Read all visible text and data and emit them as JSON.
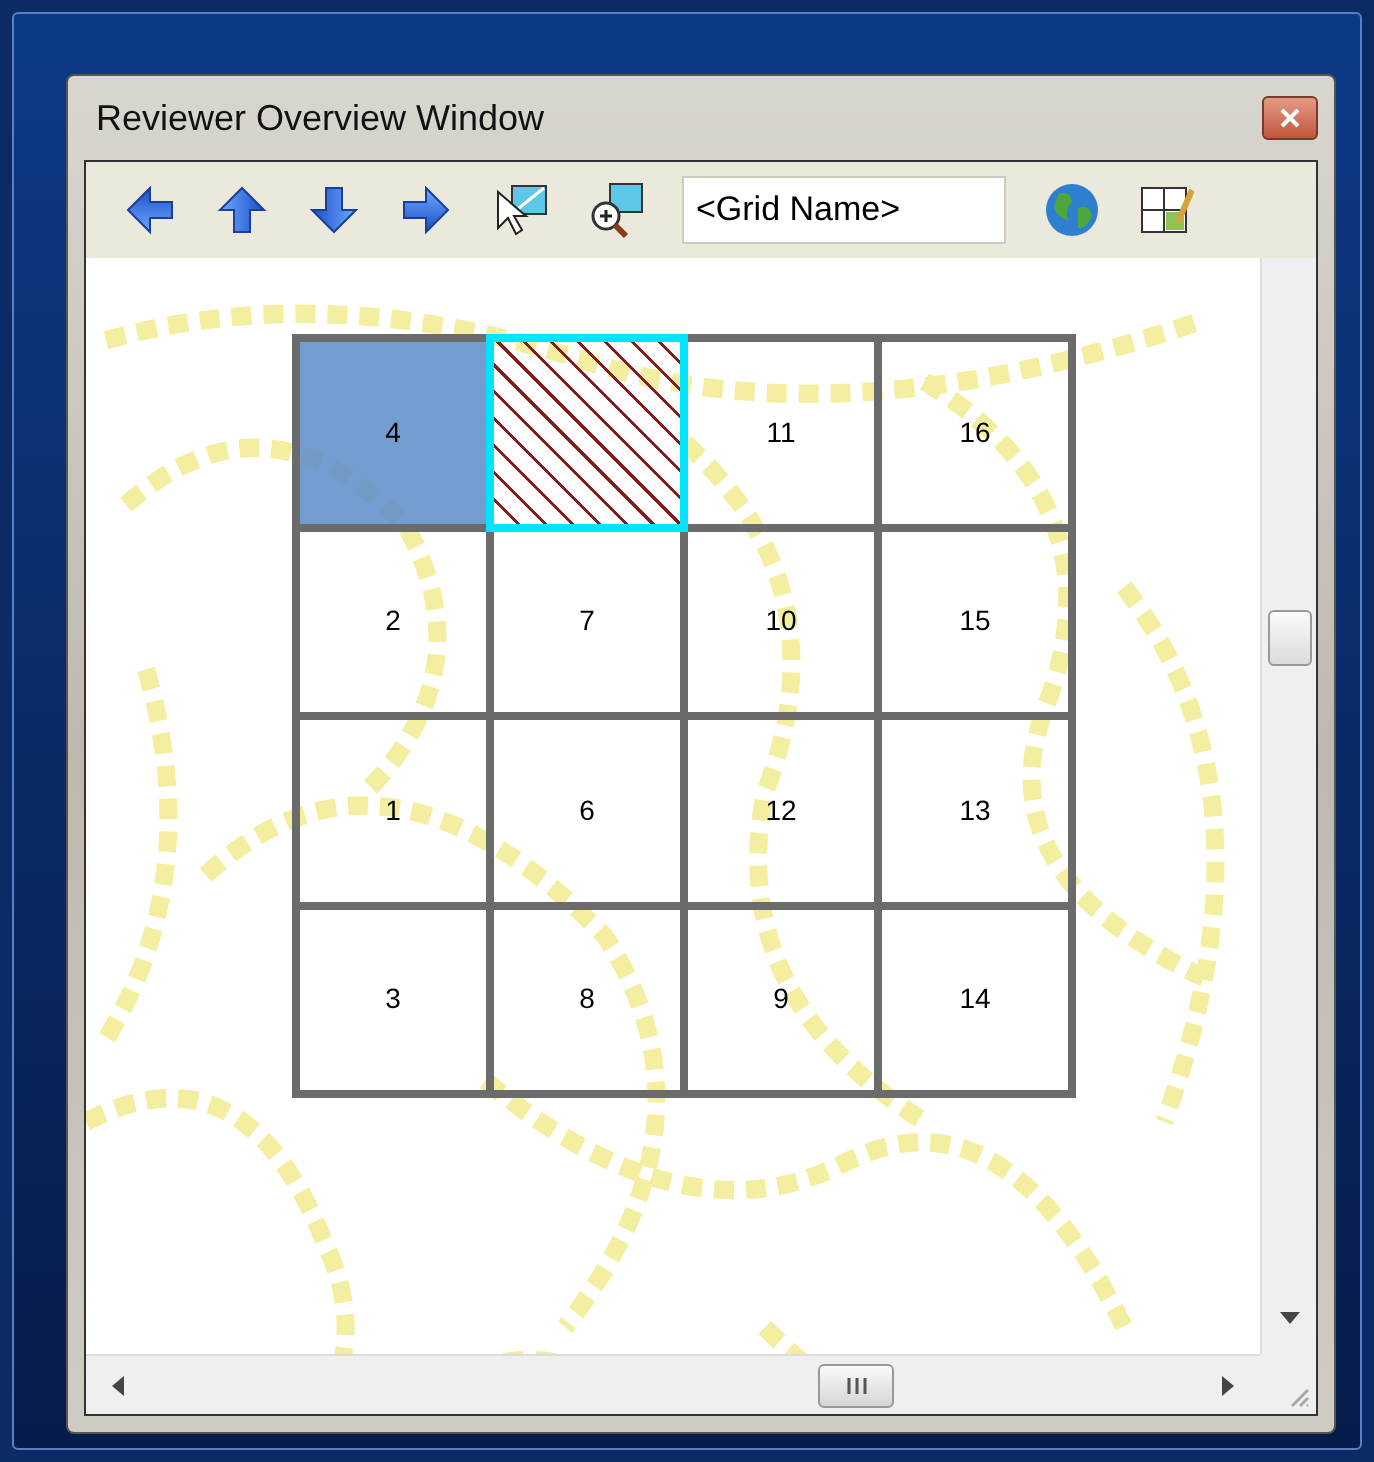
{
  "window": {
    "title": "Reviewer Overview Window"
  },
  "toolbar": {
    "grid_name": {
      "value": "<Grid Name>"
    }
  },
  "grid": {
    "cells": [
      {
        "label": "4",
        "selected": true,
        "highlighted": false
      },
      {
        "selected": false,
        "highlighted": true
      },
      {
        "label": "11",
        "selected": false,
        "highlighted": false
      },
      {
        "label": "16",
        "selected": false,
        "highlighted": false
      },
      {
        "label": "2",
        "selected": false,
        "highlighted": false
      },
      {
        "label": "7",
        "selected": false,
        "highlighted": false
      },
      {
        "label": "10",
        "selected": false,
        "highlighted": false
      },
      {
        "label": "15",
        "selected": false,
        "highlighted": false
      },
      {
        "label": "1",
        "selected": false,
        "highlighted": false
      },
      {
        "label": "6",
        "selected": false,
        "highlighted": false
      },
      {
        "label": "12",
        "selected": false,
        "highlighted": false
      },
      {
        "label": "13",
        "selected": false,
        "highlighted": false
      },
      {
        "label": "3",
        "selected": false,
        "highlighted": false
      },
      {
        "label": "8",
        "selected": false,
        "highlighted": false
      },
      {
        "label": "9",
        "selected": false,
        "highlighted": false
      },
      {
        "label": "14",
        "selected": false,
        "highlighted": false
      }
    ]
  }
}
